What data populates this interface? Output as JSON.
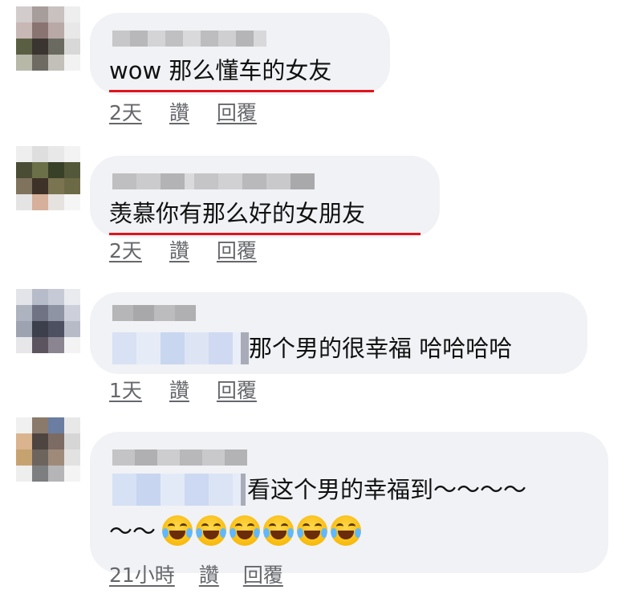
{
  "comments": [
    {
      "text": "wow 那么懂车的女友",
      "time": "2天",
      "like": "讚",
      "reply": "回覆"
    },
    {
      "text": "羡慕你有那么好的女朋友",
      "time": "2天",
      "like": "讚",
      "reply": "回覆"
    },
    {
      "text": "那个男的很幸福 哈哈哈哈",
      "time": "1天",
      "like": "讚",
      "reply": "回覆"
    },
    {
      "text_line1": "看这个男的幸福到～～～～",
      "text_line2": "～～",
      "emoji": [
        "face-with-tears-of-joy",
        "face-with-tears-of-joy",
        "face-with-tears-of-joy",
        "face-with-tears-of-joy",
        "face-with-tears-of-joy",
        "face-with-tears-of-joy"
      ],
      "time": "21小時",
      "like": "讚",
      "reply": "回覆"
    }
  ],
  "colors": {
    "bubble": "#f0f2f5",
    "meta_text": "#65676b",
    "underline": "#e0141d"
  }
}
